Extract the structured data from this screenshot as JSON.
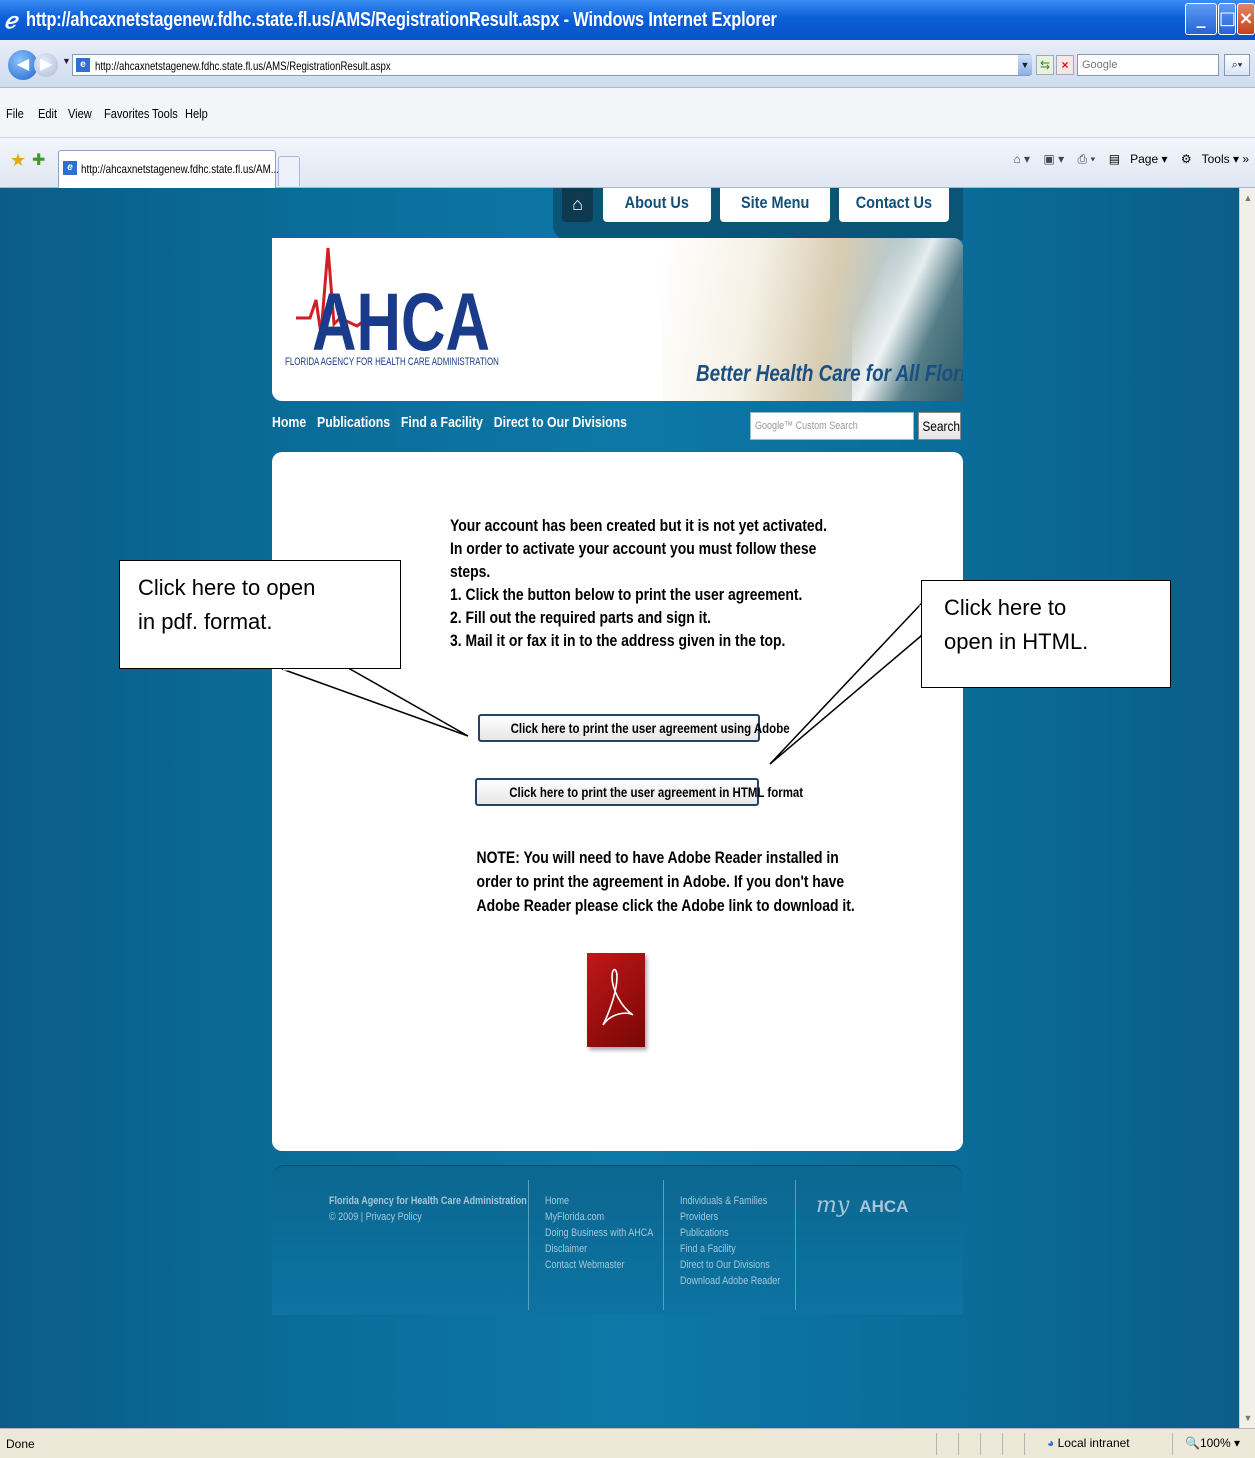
{
  "browser": {
    "window_title": "http://ahcaxnetstagenew.fdhc.state.fl.us/AMS/RegistrationResult.aspx - Windows Internet Explorer",
    "address_url": "http://ahcaxnetstagenew.fdhc.state.fl.us/AMS/RegistrationResult.aspx",
    "search_placeholder": "Google",
    "menu": [
      "File",
      "Edit",
      "View",
      "Favorites",
      "Tools",
      "Help"
    ],
    "tab_title": "http://ahcaxnetstagenew.fdhc.state.fl.us/AM...",
    "commands": {
      "page": "Page",
      "tools": "Tools"
    },
    "status": "Done",
    "zone": "Local intranet",
    "zoom": "100%"
  },
  "site": {
    "top_tabs": [
      "About Us",
      "Site Menu",
      "Contact Us"
    ],
    "logo_text": "AHCA",
    "logo_subtitle": "FLORIDA AGENCY FOR HEALTH CARE ADMINISTRATION",
    "tagline": "Better Health Care for All Floridians",
    "nav": [
      "Home",
      "Publications",
      "Find a Facility",
      "Direct to Our Divisions"
    ],
    "search_placeholder": "Google™ Custom Search",
    "search_button": "Search"
  },
  "main": {
    "instructions": [
      "Your account has been created but it is not yet activated.",
      "In order to activate your account you must follow these",
      "steps.",
      "1.  Click the button below to print the user agreement.",
      "2.  Fill out the required parts and sign it.",
      "3.  Mail it or fax it in to the address given in the top."
    ],
    "btn_adobe": "Click here to print the user agreement using Adobe",
    "btn_html": "Click here to print the user agreement in HTML format",
    "note": [
      "NOTE:  You will need to have Adobe Reader installed in",
      "order to print the agreement in Adobe.  If you don't have",
      "Adobe Reader please click the Adobe link to download it."
    ]
  },
  "footer": {
    "col1": [
      "Florida Agency for Health Care Administration",
      "© 2009 | Privacy Policy"
    ],
    "col2": [
      "Home",
      "MyFlorida.com",
      "Doing Business with AHCA",
      "Disclaimer",
      "Contact Webmaster"
    ],
    "col3": [
      "Individuals & Families",
      "Providers",
      "Publications",
      "Find a Facility",
      "Direct to Our Divisions",
      "Download Adobe Reader"
    ],
    "logo_my": "my",
    "logo_ahca": "AHCA"
  },
  "callouts": {
    "pdf": [
      "Click here to open",
      "in pdf. format."
    ],
    "html": [
      "Click here to",
      "open in HTML."
    ]
  },
  "colors": {
    "page_background": "#0d78a7",
    "ie_titlebar": "#0a5fd8",
    "brand_blue": "#1a3b8a",
    "brand_red": "#d21f26",
    "adobe_red": "#a30e0e"
  }
}
